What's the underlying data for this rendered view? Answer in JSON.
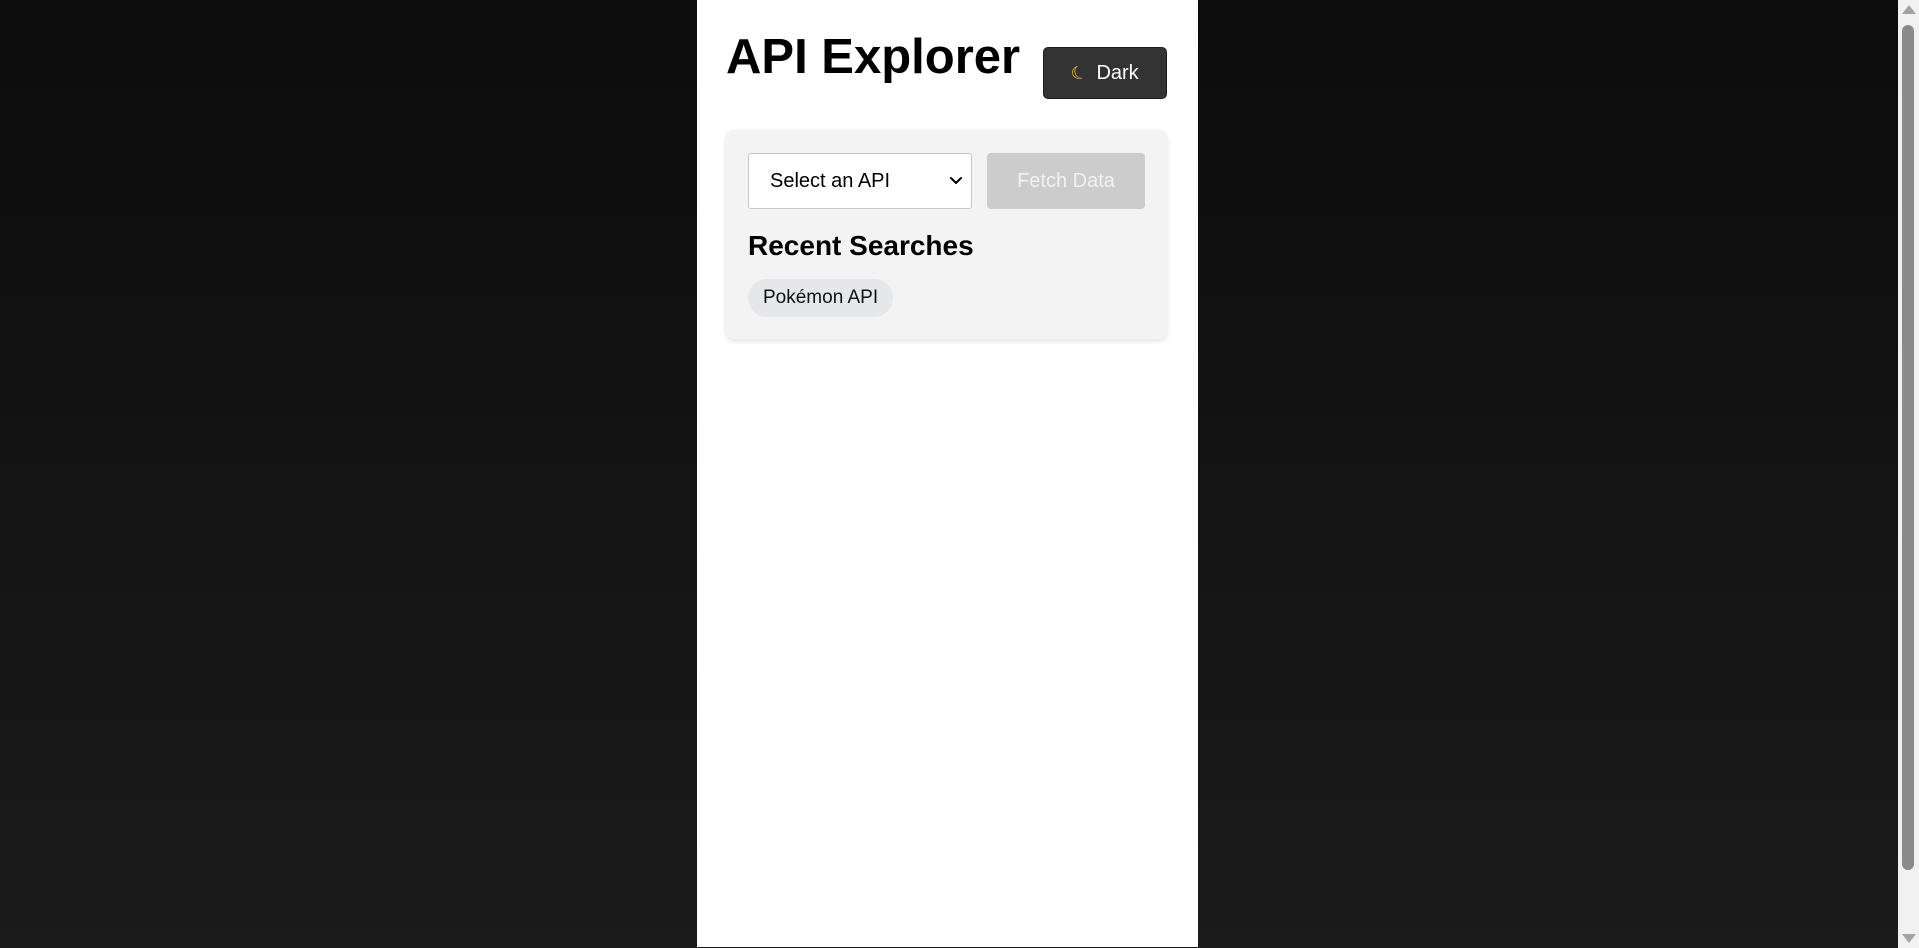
{
  "header": {
    "title": "API Explorer",
    "theme_toggle": {
      "icon": "moon-icon",
      "label": "Dark"
    }
  },
  "controls": {
    "api_select": {
      "selected": "Select an API"
    },
    "fetch_button": {
      "label": "Fetch Data",
      "disabled": true
    }
  },
  "recent": {
    "title": "Recent Searches",
    "items": [
      {
        "label": "Pokémon API"
      }
    ]
  },
  "colors": {
    "page_background": "#121212",
    "app_background": "#ffffff",
    "panel_background": "#f3f3f3",
    "toggle_background": "#333333",
    "fetch_disabled_background": "#cccccc",
    "chip_background": "#e5e7ea"
  }
}
